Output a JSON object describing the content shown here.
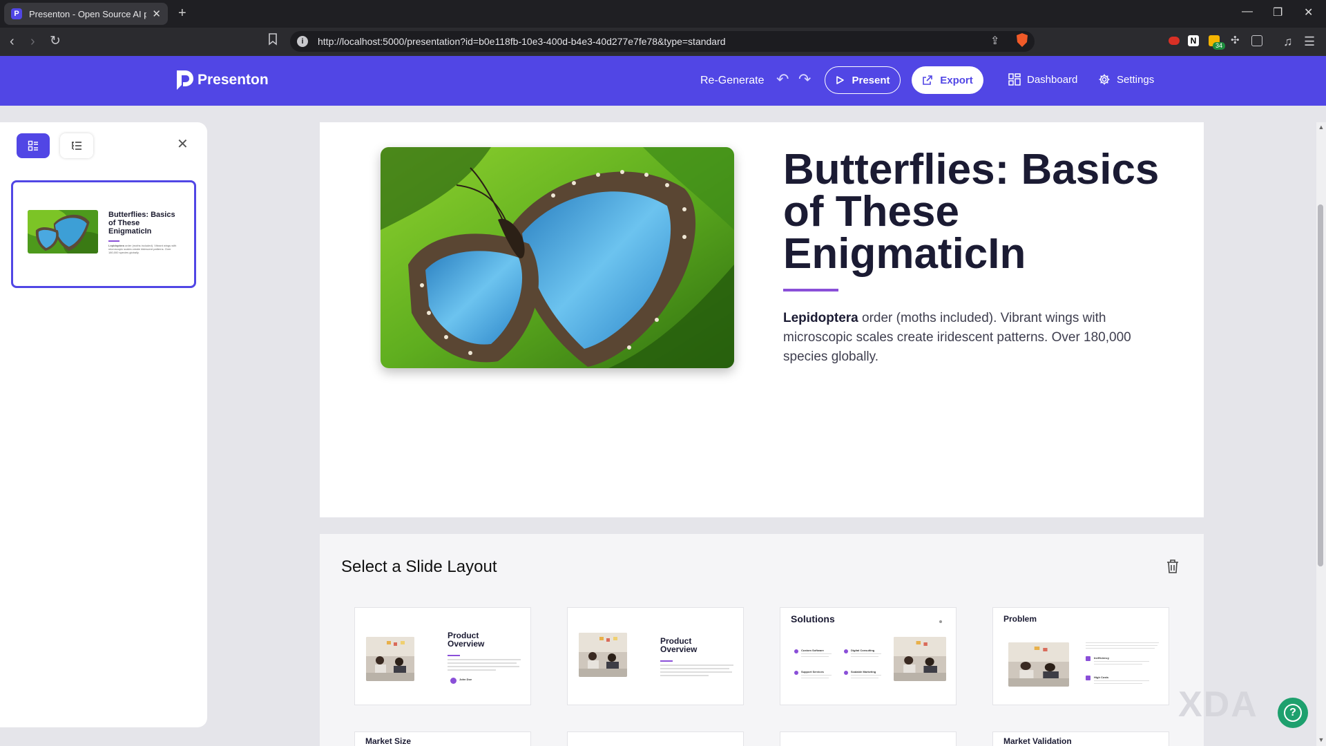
{
  "browser": {
    "tab_title": "Presenton - Open Source AI pre",
    "tab_favicon": "P",
    "url": "http://localhost:5000/presentation?id=b0e118fb-10e3-400d-b4e3-40d277e7fe78&type=standard",
    "extension_badge": "34"
  },
  "header": {
    "app_name": "Presenton",
    "regenerate_label": "Re-Generate",
    "present_label": "Present",
    "export_label": "Export",
    "dashboard_label": "Dashboard",
    "settings_label": "Settings",
    "brand_color": "#5146e5"
  },
  "sidebar": {
    "thumbnail": {
      "title": "Butterflies: Basics of These EnigmaticIn",
      "desc_bold": "Lepidoptera",
      "desc_rest": " order (moths included). Vibrant wings with microscopic scales create iridescent patterns. Over 180,000 species globally."
    }
  },
  "slide": {
    "title": "Butterflies: Basics of These EnigmaticIn",
    "desc_bold": "Lepidoptera",
    "desc_rest": " order (moths included). Vibrant wings with microscopic scales create iridescent patterns. Over 180,000 species globally.",
    "accent_color": "#8a4fd8"
  },
  "layout_picker": {
    "title": "Select a Slide Layout",
    "cards": [
      {
        "title": "Product Overview",
        "author": "John Doe"
      },
      {
        "title": "Product Overview"
      },
      {
        "title": "Solutions",
        "items": [
          "Custom Software",
          "Digital Consulting",
          "Support Services",
          "Scalable Marketing"
        ]
      },
      {
        "title": "Problem",
        "items": [
          "Inefficiency",
          "High Costs"
        ]
      }
    ],
    "next_row": [
      "Market Size",
      "Market Validation"
    ]
  },
  "overlays": {
    "watermark": "XDA"
  }
}
